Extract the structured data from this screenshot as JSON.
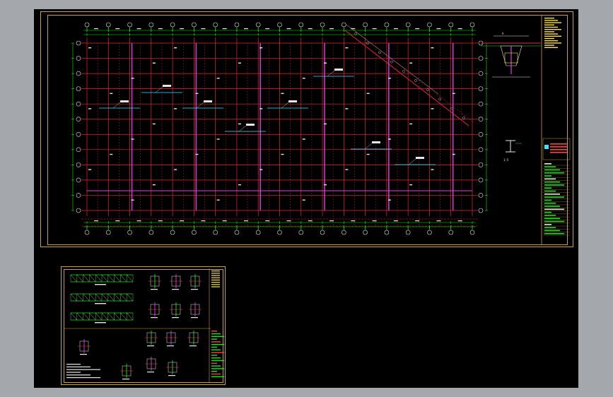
{
  "app": {
    "background": "#a4a8ad",
    "canvas_color": "#000000"
  },
  "colors": {
    "frame": "#c8a23c",
    "grid_red": "#e8243c",
    "beam_magenta": "#e040e0",
    "axis_green": "#20e020",
    "bubble_white": "#e6e6e6",
    "text_cyan": "#40e0ff",
    "title_block_yellow": "#ffe24a"
  },
  "sheet1": {
    "title_block_label": "title-block",
    "section_label": "A",
    "detail_label": "1:5"
  },
  "sheet2": {
    "title_block_label": "title-block-2"
  },
  "icons": {
    "column_symbol": "i-beam-section-icon",
    "logo": "company-logo-icon"
  }
}
